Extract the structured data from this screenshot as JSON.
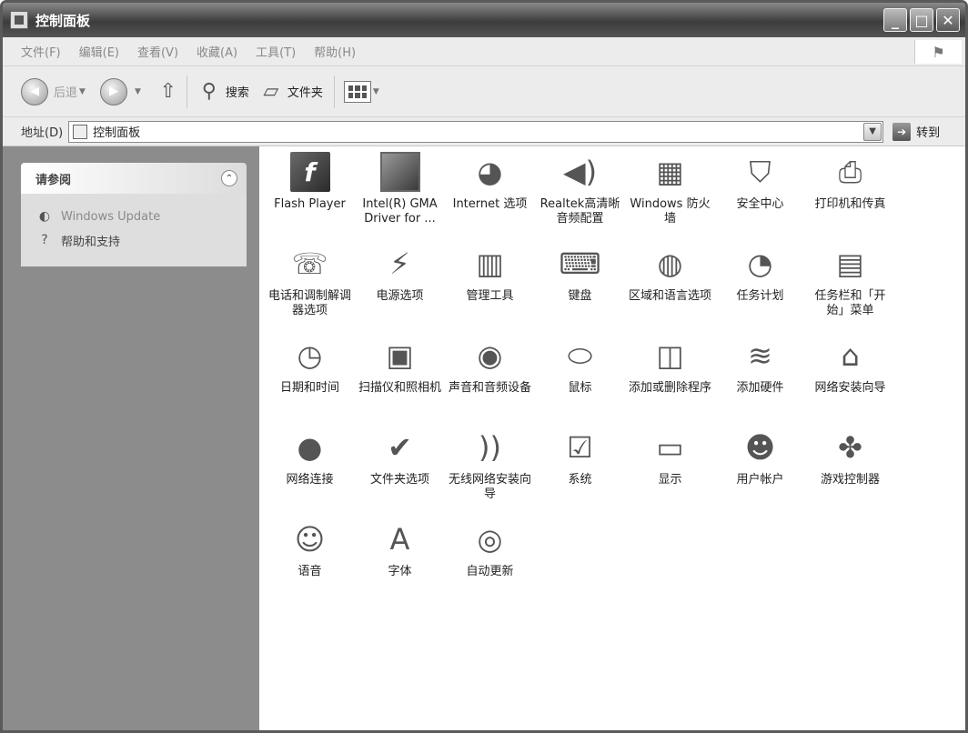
{
  "window": {
    "title": "控制面板",
    "buttons": [
      "_",
      "□",
      "✕"
    ]
  },
  "menubar": {
    "items": [
      "文件(F)",
      "编辑(E)",
      "查看(V)",
      "收藏(A)",
      "工具(T)",
      "帮助(H)"
    ]
  },
  "toolbar": {
    "back_label": "后退",
    "search_label": "搜索",
    "folders_label": "文件夹"
  },
  "address": {
    "label": "地址(D)",
    "value": "控制面板",
    "go_label": "转到"
  },
  "sidebar": {
    "panel_title": "请参阅",
    "links": [
      {
        "label": "Windows Update",
        "icon": "windows-update-icon"
      },
      {
        "label": "帮助和支持",
        "icon": "help-icon"
      }
    ]
  },
  "main": {
    "items": [
      {
        "label": "Flash Player",
        "icon": "flash-icon"
      },
      {
        "label": "Intel(R) GMA Driver for ...",
        "icon": "intel-gma-icon"
      },
      {
        "label": "Internet 选项",
        "icon": "internet-options-icon"
      },
      {
        "label": "Realtek高清晰音频配置",
        "icon": "realtek-audio-icon"
      },
      {
        "label": "Windows 防火墙",
        "icon": "firewall-icon"
      },
      {
        "label": "安全中心",
        "icon": "security-center-icon"
      },
      {
        "label": "打印机和传真",
        "icon": "printer-icon"
      },
      {
        "label": "电话和调制解调器选项",
        "icon": "phone-modem-icon"
      },
      {
        "label": "电源选项",
        "icon": "power-options-icon"
      },
      {
        "label": "管理工具",
        "icon": "admin-tools-icon"
      },
      {
        "label": "键盘",
        "icon": "keyboard-icon"
      },
      {
        "label": "区域和语言选项",
        "icon": "region-language-icon"
      },
      {
        "label": "任务计划",
        "icon": "scheduled-tasks-icon"
      },
      {
        "label": "任务栏和「开始」菜单",
        "icon": "taskbar-start-icon"
      },
      {
        "label": "日期和时间",
        "icon": "date-time-icon"
      },
      {
        "label": "扫描仪和照相机",
        "icon": "scanner-camera-icon"
      },
      {
        "label": "声音和音频设备",
        "icon": "sound-audio-icon"
      },
      {
        "label": "鼠标",
        "icon": "mouse-icon"
      },
      {
        "label": "添加或删除程序",
        "icon": "add-remove-programs-icon"
      },
      {
        "label": "添加硬件",
        "icon": "add-hardware-icon"
      },
      {
        "label": "网络安装向导",
        "icon": "network-setup-wizard-icon"
      },
      {
        "label": "网络连接",
        "icon": "network-connections-icon"
      },
      {
        "label": "文件夹选项",
        "icon": "folder-options-icon"
      },
      {
        "label": "无线网络安装向导",
        "icon": "wireless-setup-icon"
      },
      {
        "label": "系统",
        "icon": "system-icon"
      },
      {
        "label": "显示",
        "icon": "display-icon"
      },
      {
        "label": "用户帐户",
        "icon": "user-accounts-icon"
      },
      {
        "label": "游戏控制器",
        "icon": "game-controllers-icon"
      },
      {
        "label": "语音",
        "icon": "speech-icon"
      },
      {
        "label": "字体",
        "icon": "fonts-icon"
      },
      {
        "label": "自动更新",
        "icon": "automatic-updates-icon"
      }
    ]
  }
}
